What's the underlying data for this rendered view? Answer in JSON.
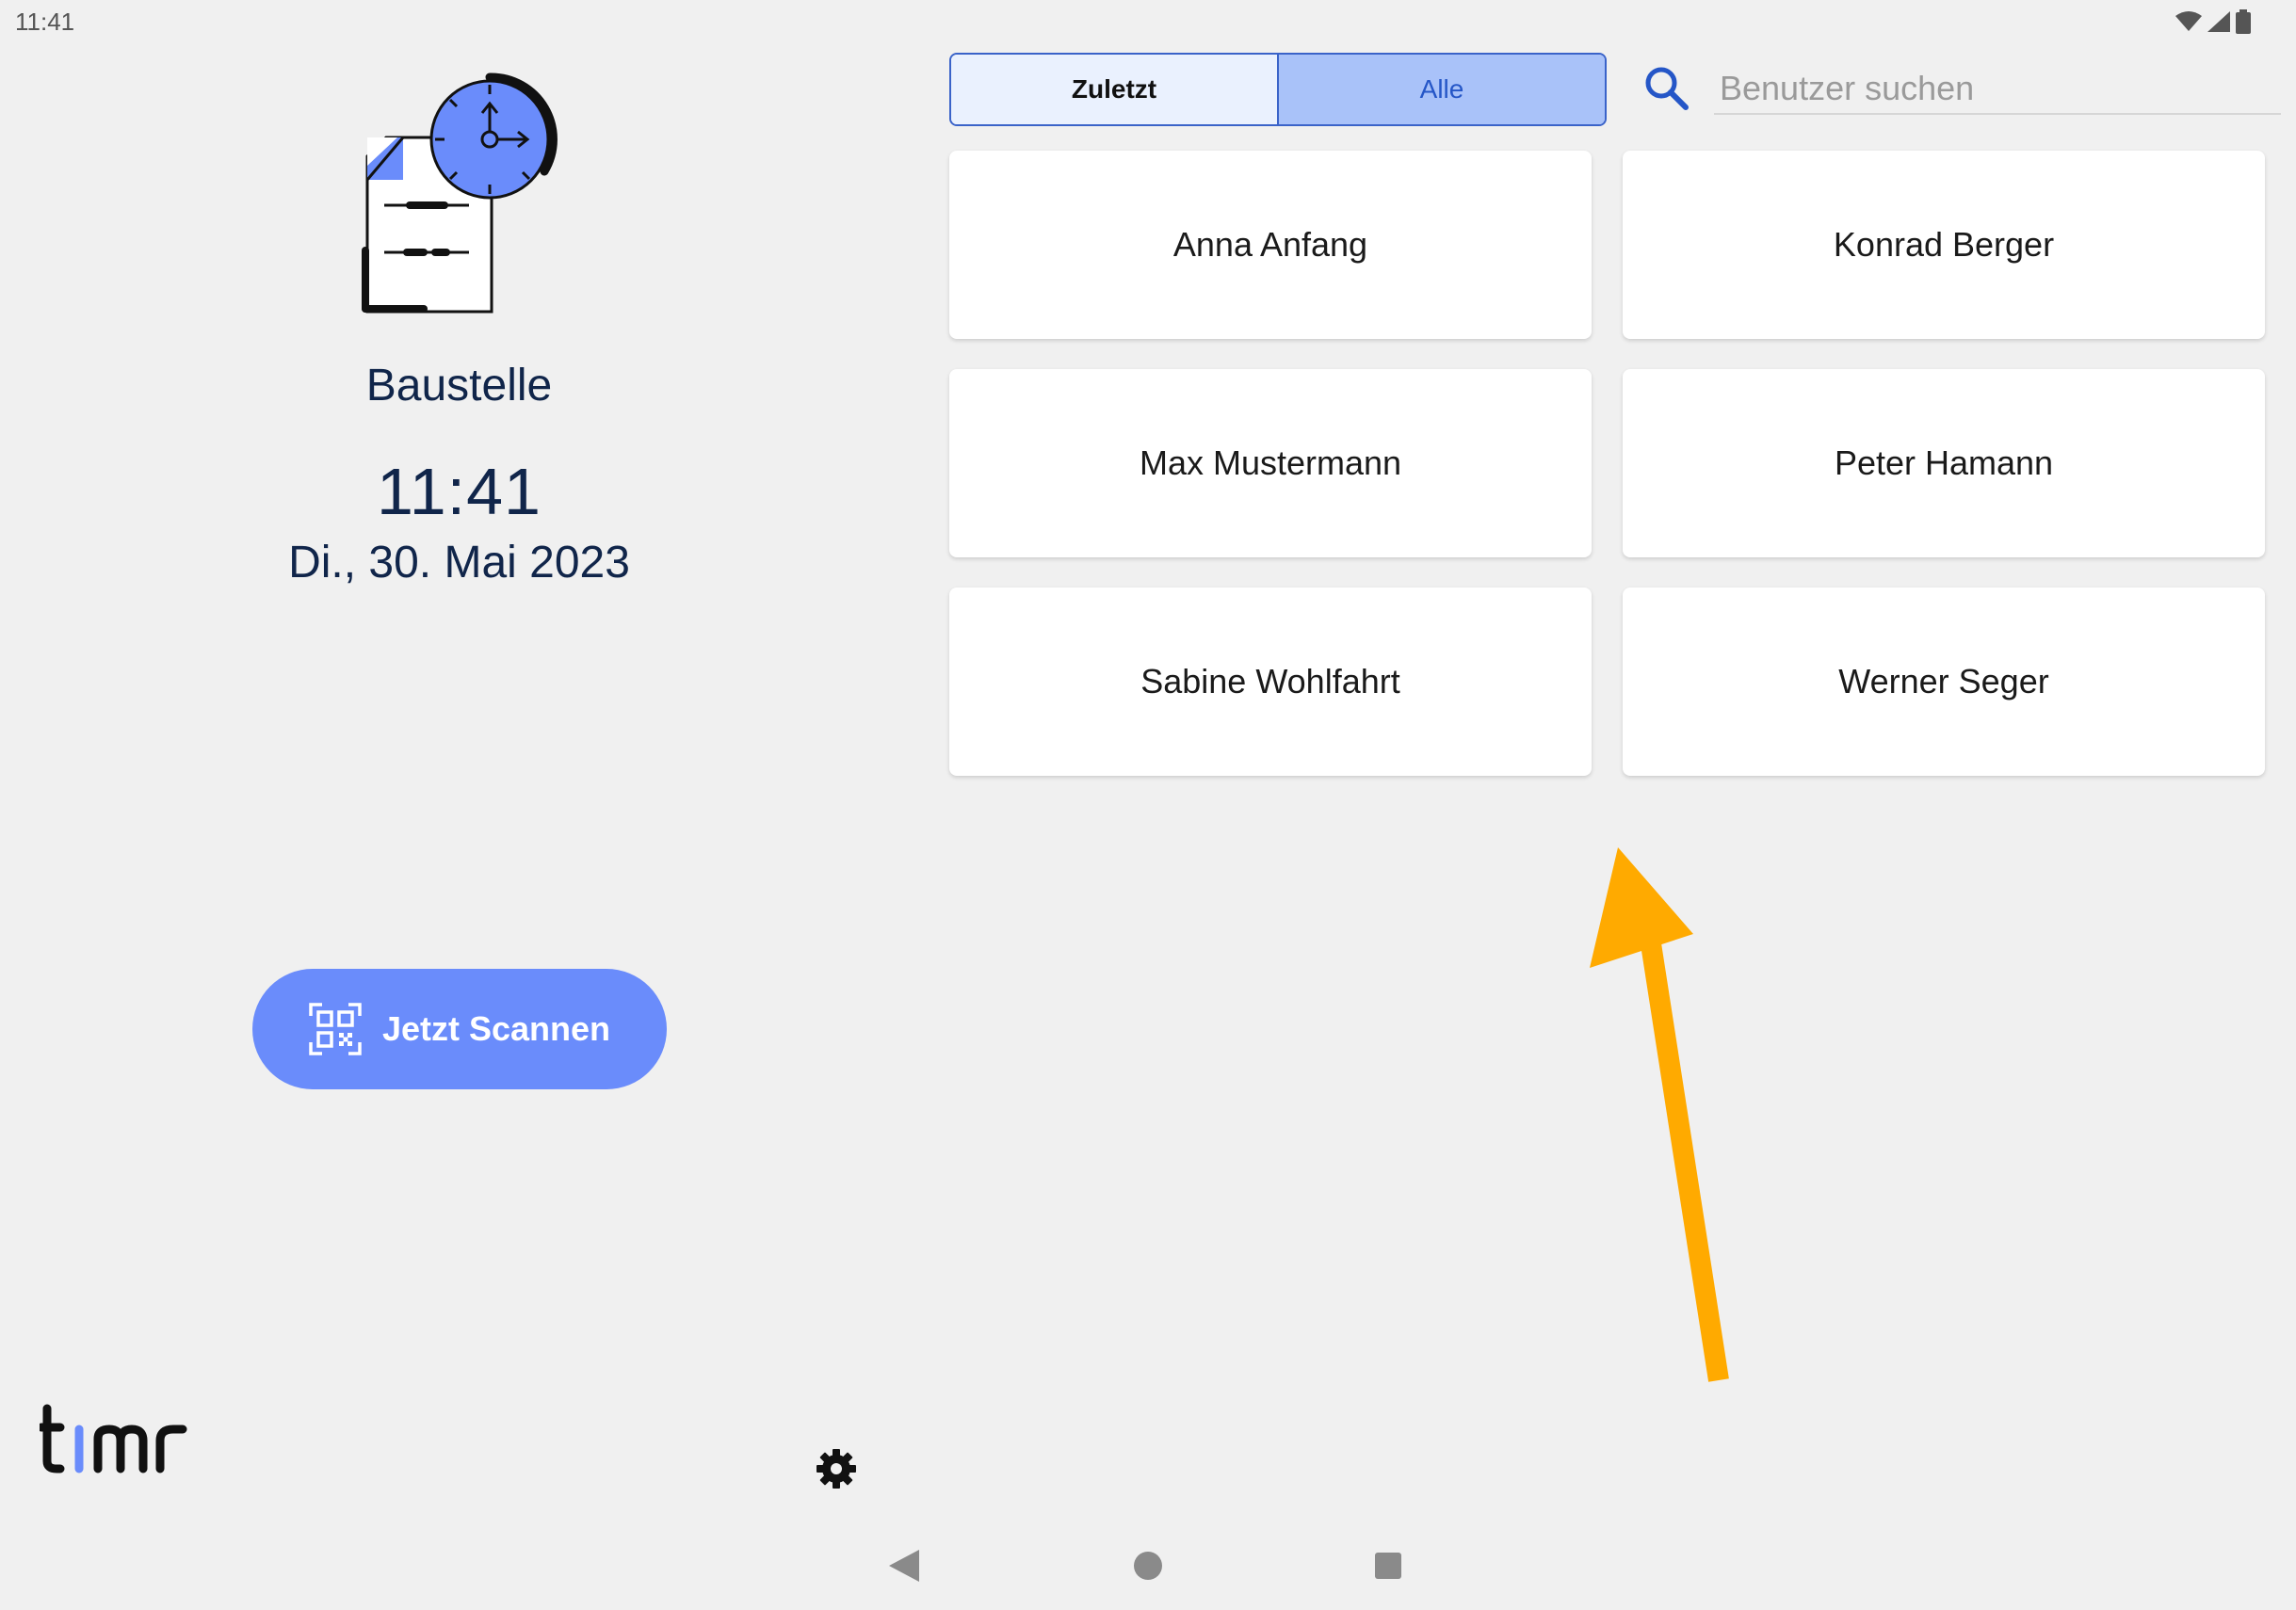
{
  "status_bar": {
    "time": "11:41"
  },
  "left_panel": {
    "illustration_icon": "document-clock-icon",
    "location": "Baustelle",
    "time": "11:41",
    "date": "Di., 30. Mai 2023",
    "scan_button": {
      "label": "Jetzt Scannen",
      "icon": "qr-code-icon"
    },
    "logo_text": "timr",
    "settings_icon": "gear-icon"
  },
  "tabs": [
    {
      "label": "Zuletzt",
      "selected": false
    },
    {
      "label": "Alle",
      "selected": true
    }
  ],
  "search": {
    "placeholder": "Benutzer suchen",
    "value": ""
  },
  "users": [
    "Anna Anfang",
    "Konrad Berger",
    "Max Mustermann",
    "Peter Hamann",
    "Sabine Wohlfahrt",
    "Werner Seger"
  ],
  "colors": {
    "background": "#f0f0f0",
    "primary": "#6a8cfb",
    "segment_border": "#3a63c9",
    "segment_selected": "#a9c2f9",
    "text_dark": "#10254a",
    "annotation_arrow": "#ffaa00"
  },
  "navigation": {
    "back_icon": "back-triangle-icon",
    "home_icon": "home-circle-icon",
    "recents_icon": "recents-square-icon"
  }
}
